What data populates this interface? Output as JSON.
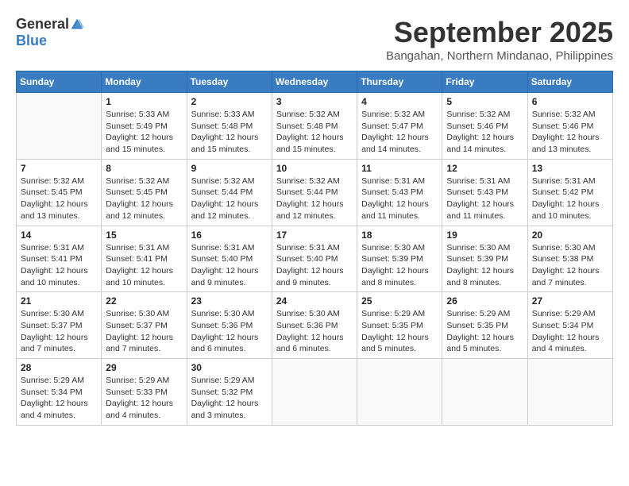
{
  "logo": {
    "general": "General",
    "blue": "Blue"
  },
  "title": "September 2025",
  "location": "Bangahan, Northern Mindanao, Philippines",
  "days_of_week": [
    "Sunday",
    "Monday",
    "Tuesday",
    "Wednesday",
    "Thursday",
    "Friday",
    "Saturday"
  ],
  "weeks": [
    [
      {
        "day": "",
        "info": ""
      },
      {
        "day": "1",
        "info": "Sunrise: 5:33 AM\nSunset: 5:49 PM\nDaylight: 12 hours\nand 15 minutes."
      },
      {
        "day": "2",
        "info": "Sunrise: 5:33 AM\nSunset: 5:48 PM\nDaylight: 12 hours\nand 15 minutes."
      },
      {
        "day": "3",
        "info": "Sunrise: 5:32 AM\nSunset: 5:48 PM\nDaylight: 12 hours\nand 15 minutes."
      },
      {
        "day": "4",
        "info": "Sunrise: 5:32 AM\nSunset: 5:47 PM\nDaylight: 12 hours\nand 14 minutes."
      },
      {
        "day": "5",
        "info": "Sunrise: 5:32 AM\nSunset: 5:46 PM\nDaylight: 12 hours\nand 14 minutes."
      },
      {
        "day": "6",
        "info": "Sunrise: 5:32 AM\nSunset: 5:46 PM\nDaylight: 12 hours\nand 13 minutes."
      }
    ],
    [
      {
        "day": "7",
        "info": "Sunrise: 5:32 AM\nSunset: 5:45 PM\nDaylight: 12 hours\nand 13 minutes."
      },
      {
        "day": "8",
        "info": "Sunrise: 5:32 AM\nSunset: 5:45 PM\nDaylight: 12 hours\nand 12 minutes."
      },
      {
        "day": "9",
        "info": "Sunrise: 5:32 AM\nSunset: 5:44 PM\nDaylight: 12 hours\nand 12 minutes."
      },
      {
        "day": "10",
        "info": "Sunrise: 5:32 AM\nSunset: 5:44 PM\nDaylight: 12 hours\nand 12 minutes."
      },
      {
        "day": "11",
        "info": "Sunrise: 5:31 AM\nSunset: 5:43 PM\nDaylight: 12 hours\nand 11 minutes."
      },
      {
        "day": "12",
        "info": "Sunrise: 5:31 AM\nSunset: 5:43 PM\nDaylight: 12 hours\nand 11 minutes."
      },
      {
        "day": "13",
        "info": "Sunrise: 5:31 AM\nSunset: 5:42 PM\nDaylight: 12 hours\nand 10 minutes."
      }
    ],
    [
      {
        "day": "14",
        "info": "Sunrise: 5:31 AM\nSunset: 5:41 PM\nDaylight: 12 hours\nand 10 minutes."
      },
      {
        "day": "15",
        "info": "Sunrise: 5:31 AM\nSunset: 5:41 PM\nDaylight: 12 hours\nand 10 minutes."
      },
      {
        "day": "16",
        "info": "Sunrise: 5:31 AM\nSunset: 5:40 PM\nDaylight: 12 hours\nand 9 minutes."
      },
      {
        "day": "17",
        "info": "Sunrise: 5:31 AM\nSunset: 5:40 PM\nDaylight: 12 hours\nand 9 minutes."
      },
      {
        "day": "18",
        "info": "Sunrise: 5:30 AM\nSunset: 5:39 PM\nDaylight: 12 hours\nand 8 minutes."
      },
      {
        "day": "19",
        "info": "Sunrise: 5:30 AM\nSunset: 5:39 PM\nDaylight: 12 hours\nand 8 minutes."
      },
      {
        "day": "20",
        "info": "Sunrise: 5:30 AM\nSunset: 5:38 PM\nDaylight: 12 hours\nand 7 minutes."
      }
    ],
    [
      {
        "day": "21",
        "info": "Sunrise: 5:30 AM\nSunset: 5:37 PM\nDaylight: 12 hours\nand 7 minutes."
      },
      {
        "day": "22",
        "info": "Sunrise: 5:30 AM\nSunset: 5:37 PM\nDaylight: 12 hours\nand 7 minutes."
      },
      {
        "day": "23",
        "info": "Sunrise: 5:30 AM\nSunset: 5:36 PM\nDaylight: 12 hours\nand 6 minutes."
      },
      {
        "day": "24",
        "info": "Sunrise: 5:30 AM\nSunset: 5:36 PM\nDaylight: 12 hours\nand 6 minutes."
      },
      {
        "day": "25",
        "info": "Sunrise: 5:29 AM\nSunset: 5:35 PM\nDaylight: 12 hours\nand 5 minutes."
      },
      {
        "day": "26",
        "info": "Sunrise: 5:29 AM\nSunset: 5:35 PM\nDaylight: 12 hours\nand 5 minutes."
      },
      {
        "day": "27",
        "info": "Sunrise: 5:29 AM\nSunset: 5:34 PM\nDaylight: 12 hours\nand 4 minutes."
      }
    ],
    [
      {
        "day": "28",
        "info": "Sunrise: 5:29 AM\nSunset: 5:34 PM\nDaylight: 12 hours\nand 4 minutes."
      },
      {
        "day": "29",
        "info": "Sunrise: 5:29 AM\nSunset: 5:33 PM\nDaylight: 12 hours\nand 4 minutes."
      },
      {
        "day": "30",
        "info": "Sunrise: 5:29 AM\nSunset: 5:32 PM\nDaylight: 12 hours\nand 3 minutes."
      },
      {
        "day": "",
        "info": ""
      },
      {
        "day": "",
        "info": ""
      },
      {
        "day": "",
        "info": ""
      },
      {
        "day": "",
        "info": ""
      }
    ]
  ]
}
